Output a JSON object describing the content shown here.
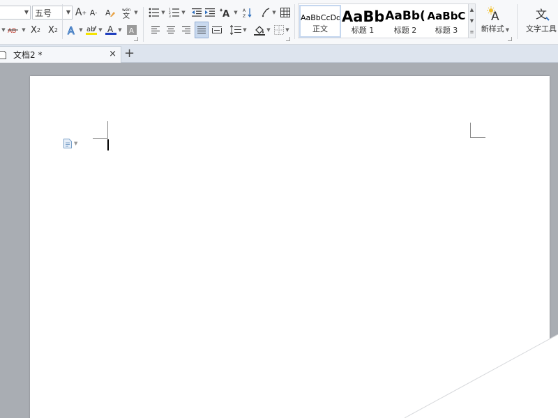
{
  "ribbon": {
    "font_size": "五号",
    "styles": [
      {
        "sample": "AaBbCcDd",
        "label": "正文"
      },
      {
        "sample": "AaBb",
        "label": "标题 1"
      },
      {
        "sample": "AaBb(",
        "label": "标题 2"
      },
      {
        "sample": "AaBbC",
        "label": "标题 3"
      }
    ],
    "new_style_label": "新样式",
    "text_tools_label": "文字工具",
    "accent_color": "#2f6fbd",
    "highlight_color": "#f5e300",
    "font_color": "#1f3fbf"
  },
  "tab": {
    "name": "文档2 *",
    "close_glyph": "×",
    "new_tab_glyph": "+"
  }
}
